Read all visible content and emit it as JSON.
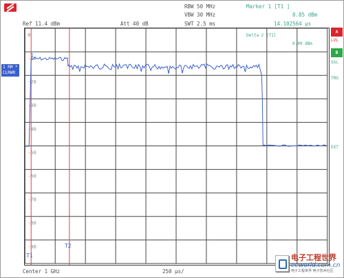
{
  "header": {
    "rbw_label": "RBW 50 MHz",
    "vbw_label": "VBW 30 MHz",
    "swt_label": "SWT 2.5 ms",
    "ref_label": "Ref  11.4 dBm",
    "att_label": "Att  40 dB",
    "marker_title": "Marker 1 [T1 ]",
    "marker_level": "0.85 dBm",
    "marker_time": "14.102564 µs",
    "delta_label": "Delta 2 [T1]",
    "delta_level": "0.00 dBm"
  },
  "trace_badge": {
    "line1": "1 RM *",
    "line2": "CLRWR"
  },
  "side_panel": {
    "a_label": "A",
    "lvl_label": "LVL",
    "b_label": "B",
    "sgl_label": "SGL",
    "trg_label": "TRG",
    "ext_label": "EXT"
  },
  "plot": {
    "y_ticks": [
      "0",
      "-10",
      "-20",
      "-30",
      "-40",
      "-50",
      "-60",
      "-70",
      "-80",
      "-90"
    ],
    "markers": [
      "1",
      "T1",
      "T2"
    ]
  },
  "footer": {
    "center_label": "Center 1 GHz",
    "span_label": "250 µs/"
  },
  "watermark": {
    "title": "电子工程世界",
    "sub": "eeworld.com.cn",
    "cn": "电子工程世界 电子技术社区"
  },
  "colors": {
    "trace": "#3a5fcd",
    "grid": "#444444",
    "marker_line": "#e04040",
    "badge_bg": "#3a5fcd",
    "logo": "#d8262c",
    "panel_red": "#d8262c",
    "panel_green": "#2ea84a"
  }
}
